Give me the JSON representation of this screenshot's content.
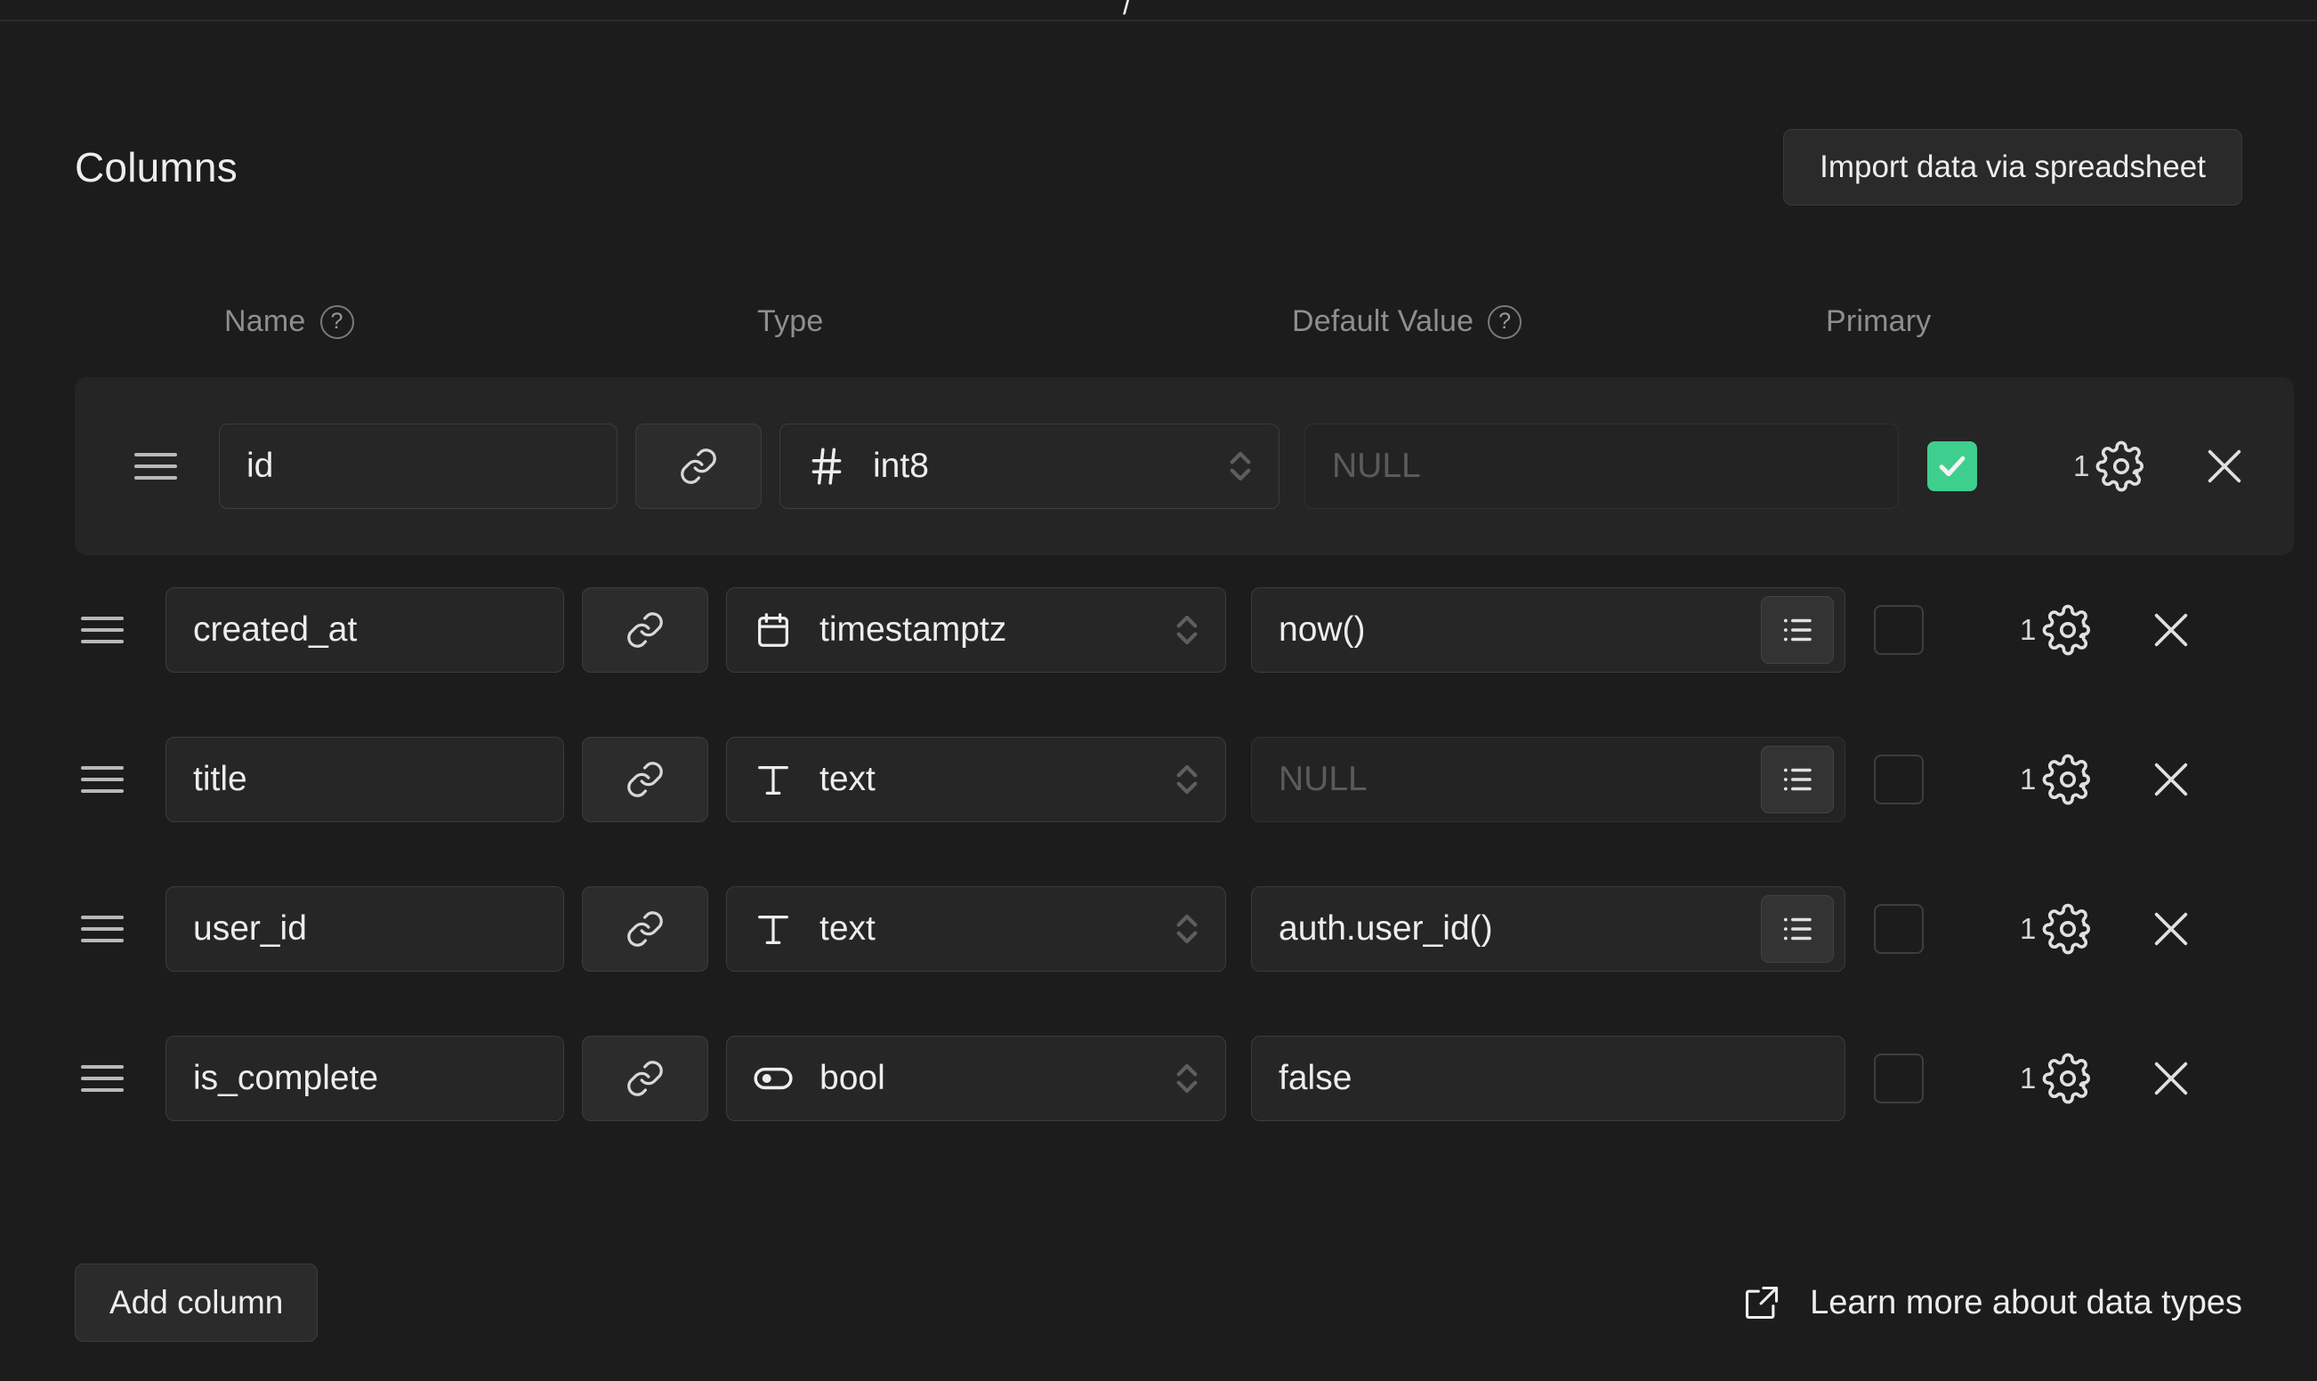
{
  "top_fragment": "/",
  "header": {
    "title": "Columns",
    "import_button": "Import data via spreadsheet"
  },
  "table_headers": {
    "name": "Name",
    "type": "Type",
    "default_value": "Default Value",
    "primary": "Primary",
    "help_icon": "?"
  },
  "columns": [
    {
      "name": "id",
      "type": "int8",
      "type_icon": "hash-icon",
      "default_value": "NULL",
      "default_is_placeholder": true,
      "has_list_button": false,
      "primary": true,
      "settings_badge": "1"
    },
    {
      "name": "created_at",
      "type": "timestamptz",
      "type_icon": "calendar-icon",
      "default_value": "now()",
      "default_is_placeholder": false,
      "has_list_button": true,
      "primary": false,
      "settings_badge": "1"
    },
    {
      "name": "title",
      "type": "text",
      "type_icon": "text-icon",
      "default_value": "NULL",
      "default_is_placeholder": true,
      "has_list_button": true,
      "primary": false,
      "settings_badge": "1"
    },
    {
      "name": "user_id",
      "type": "text",
      "type_icon": "text-icon",
      "default_value": "auth.user_id()",
      "default_is_placeholder": false,
      "has_list_button": true,
      "primary": false,
      "settings_badge": "1"
    },
    {
      "name": "is_complete",
      "type": "bool",
      "type_icon": "toggle-icon",
      "default_value": "false",
      "default_is_placeholder": false,
      "has_list_button": false,
      "primary": false,
      "settings_badge": "1"
    }
  ],
  "footer": {
    "add_column": "Add column",
    "learn_more": "Learn more about data types"
  },
  "colors": {
    "background": "#1c1c1c",
    "accent_green": "#3ECF8E",
    "text_primary": "#ededed",
    "text_muted": "#8e8e8e",
    "field_background": "#262626",
    "field_border": "#3c3c3c"
  }
}
